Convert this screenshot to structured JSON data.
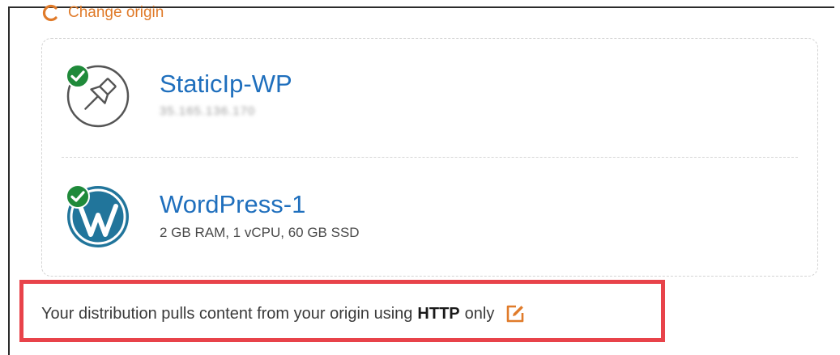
{
  "header": {
    "change_origin_label": "Change origin"
  },
  "origin": {
    "static_ip": {
      "name": "StaticIp-WP",
      "address": "35.165.136.170",
      "address_redacted": true
    },
    "instance": {
      "name": "WordPress-1",
      "specs": "2 GB RAM, 1 vCPU, 60 GB SSD"
    }
  },
  "distribution": {
    "text_before": "Your distribution pulls content from your origin using",
    "protocol": "HTTP",
    "text_after": "only"
  },
  "colors": {
    "accent_orange": "#e07b2a",
    "link_blue": "#1f6fbd",
    "check_green": "#1f8a3a",
    "highlight_red": "#e8434a",
    "wordpress_blue": "#21759b"
  },
  "icons": {
    "change_origin": "refresh-icon",
    "static_ip": "pushpin-icon",
    "instance": "wordpress-icon",
    "status": "check-circle-icon",
    "edit": "edit-icon"
  }
}
